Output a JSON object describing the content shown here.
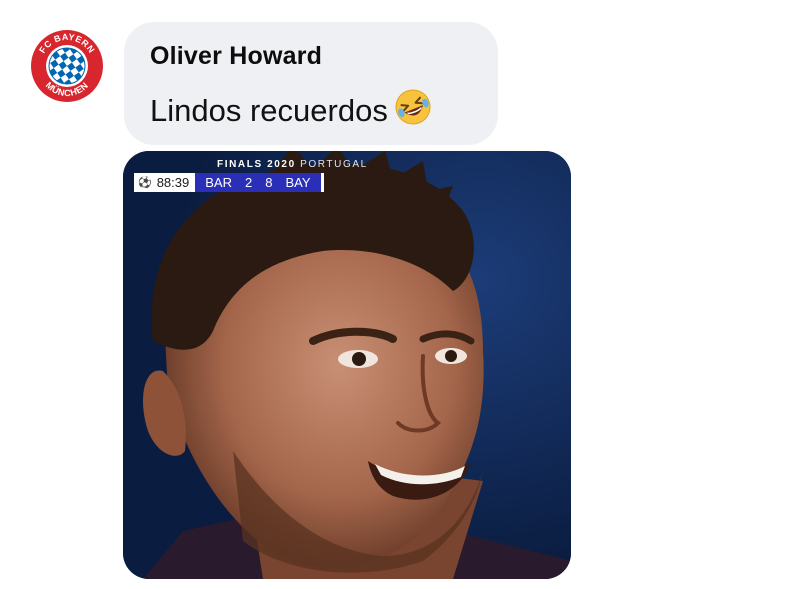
{
  "comment": {
    "author": "Oliver Howard",
    "text": "Lindos recuerdos",
    "emoji_icon": "rolling-on-floor-laughing-icon",
    "avatar": {
      "name": "fc-bayern-munchen-logo",
      "ring_text_top": "FC BAYERN",
      "ring_text_bottom": "MÜNCHEN",
      "colors": {
        "red": "#d8262e",
        "blue": "#0066b2"
      }
    }
  },
  "attachment": {
    "caption": {
      "bold": "FINALS 2020",
      "light": "PORTUGAL"
    },
    "scoreboard": {
      "clock": "88:39",
      "home_team": "BAR",
      "home_score": "2",
      "away_score": "8",
      "away_team": "BAY",
      "colors": {
        "bar": "#2b2fb8",
        "clock_bg": "#ffffff"
      }
    }
  },
  "colors": {
    "bubble_bg": "#eff0f3",
    "author_text": "#0d0d0d",
    "photo_bg": "#12295a"
  }
}
